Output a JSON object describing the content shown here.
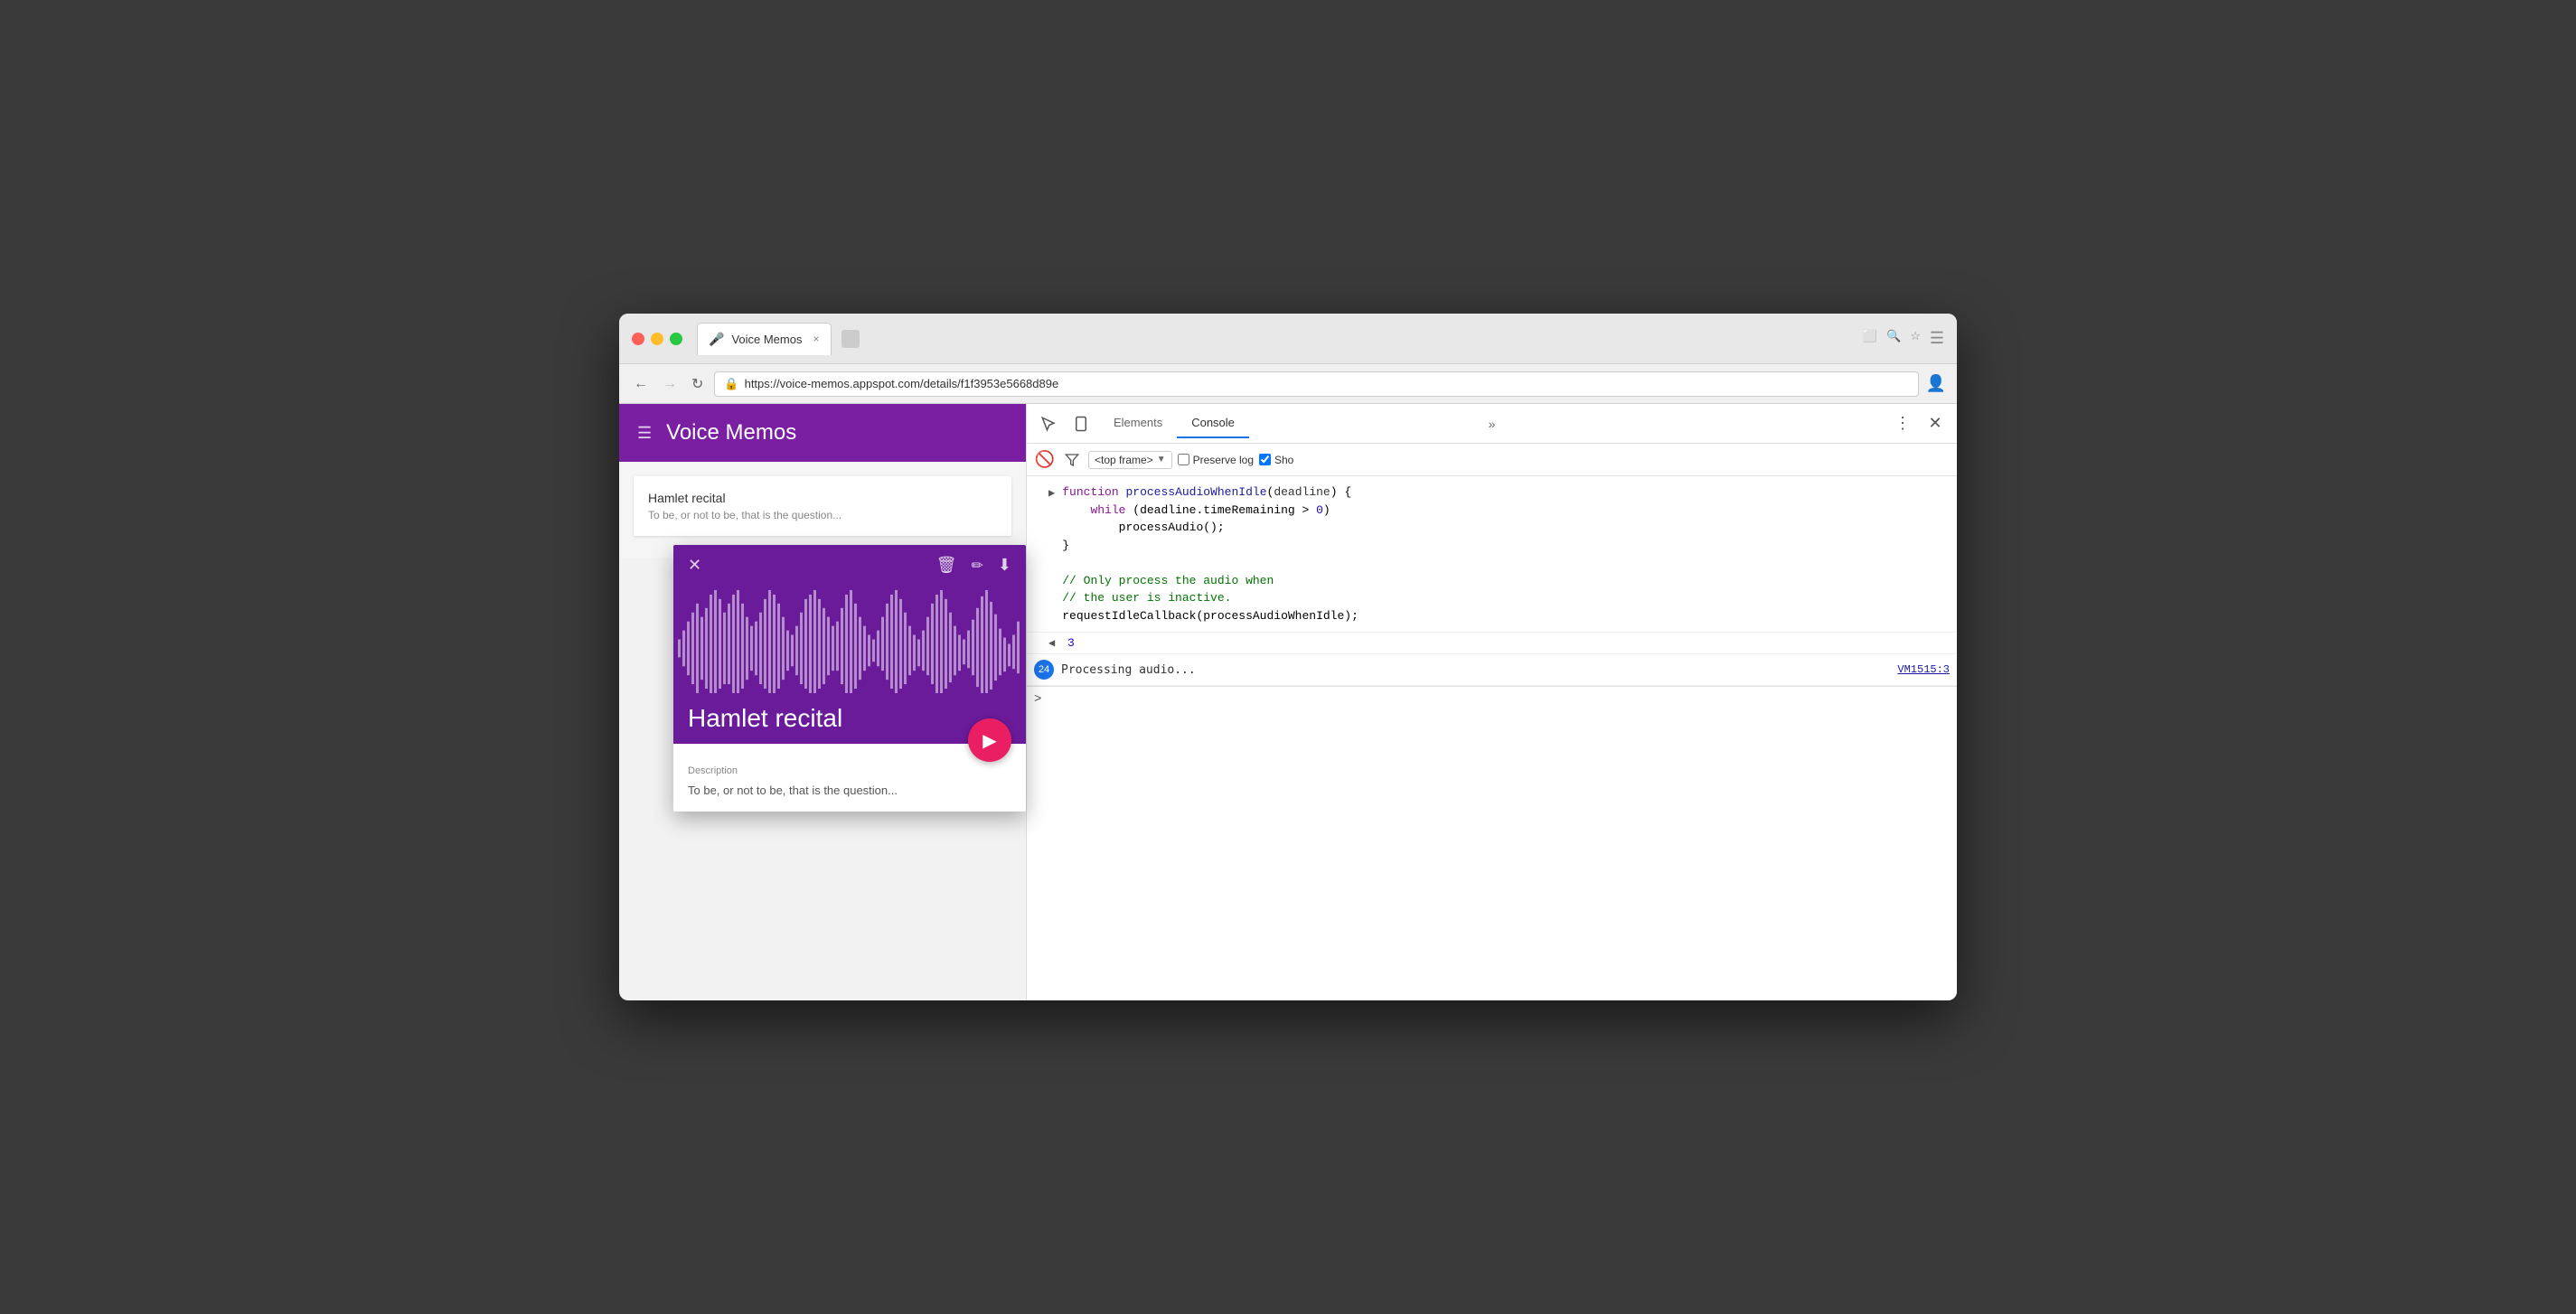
{
  "browser": {
    "traffic_lights": [
      "red",
      "yellow",
      "green"
    ],
    "tab": {
      "icon": "🎤",
      "title": "Voice Memos",
      "close": "×"
    },
    "url": "https://voice-memos.appspot.com/details/f1f3953e5668d89e",
    "nav": {
      "back": "←",
      "forward": "→",
      "reload": "↺"
    }
  },
  "webapp": {
    "header": {
      "hamburger": "☰",
      "title": "Voice Memos"
    },
    "memo_card": {
      "title": "Hamlet recital",
      "description": "To be, or not to be, that is the question..."
    }
  },
  "modal": {
    "close_icon": "✕",
    "delete_icon": "🗑",
    "edit_icon": "✏",
    "download_icon": "⬇",
    "title": "Hamlet recital",
    "play_icon": "▶",
    "description_label": "Description",
    "description_text": "To be, or not to be, that is the question...",
    "header_bg": "#6a1b9a",
    "play_btn_bg": "#e91e63"
  },
  "devtools": {
    "tabs": [
      "Elements",
      "Console"
    ],
    "active_tab": "Console",
    "more_label": "»",
    "console_toolbar": {
      "no_entry": "🚫",
      "filter_icon": "▽",
      "frame_label": "<top frame>",
      "preserve_log": "Preserve log",
      "show_label": "Sho"
    },
    "console_code": {
      "arrow": "▶",
      "line1": "function processAudioWhenIdle(deadline) {",
      "line2": "    while (deadline.timeRemaining > 0)",
      "line3": "        processAudio();",
      "line4": "}",
      "line5": "",
      "line6": "// Only process the audio when",
      "line7": "// the user is inactive.",
      "line8": "requestIdleCallback(processAudioWhenIdle);"
    },
    "console_return": {
      "arrow": "◀",
      "value": "3"
    },
    "console_log": {
      "count": "24",
      "text": "Processing audio...",
      "source": "VM1515:3"
    },
    "console_input": {
      "prompt": ">"
    }
  }
}
